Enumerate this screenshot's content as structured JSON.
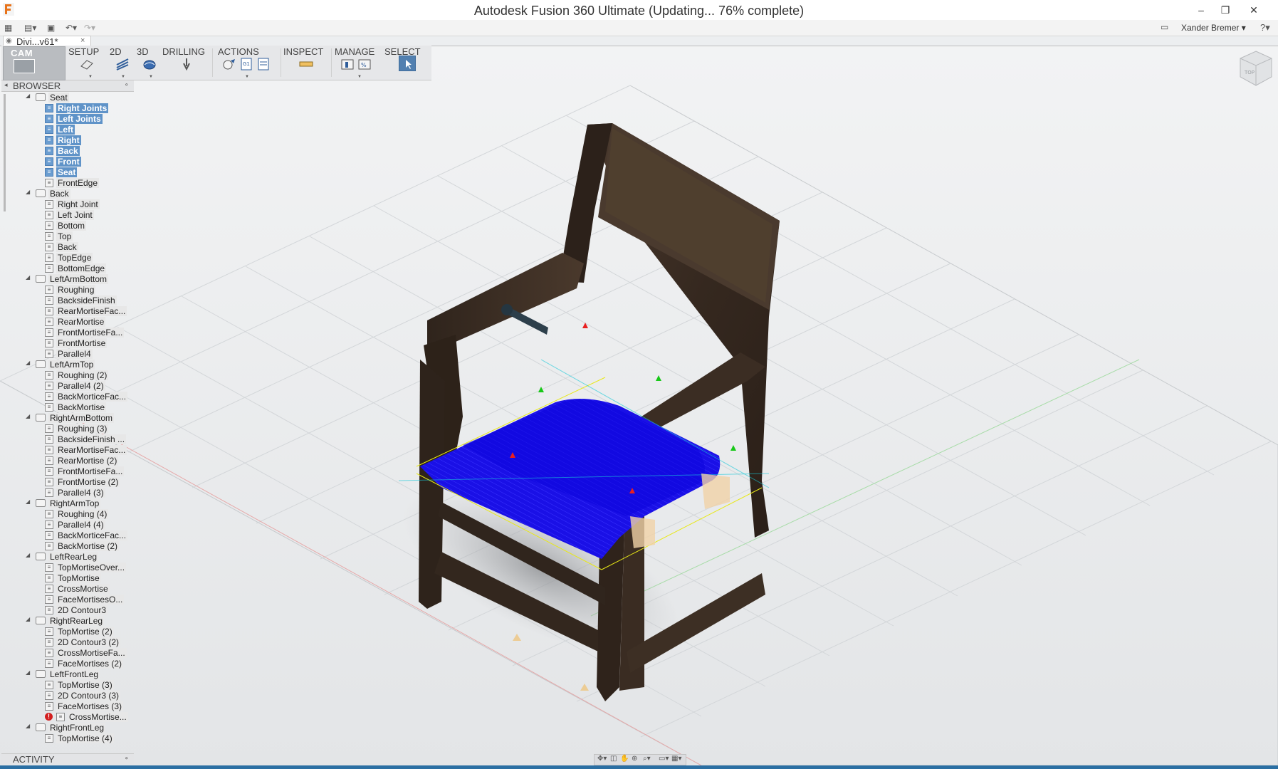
{
  "window": {
    "title": "Autodesk Fusion 360 Ultimate  (Updating... 76% complete)",
    "minimize": "–",
    "maximize": "❐",
    "close": "✕"
  },
  "quickaccess": {
    "user": "Xander Bremer ▾",
    "help": "?▾"
  },
  "document": {
    "tab_label": "Divi...v61*",
    "close": "×"
  },
  "ribbon": {
    "workspace": "CAM",
    "groups": [
      "SETUP",
      "2D",
      "3D",
      "DRILLING",
      "ACTIONS",
      "INSPECT",
      "MANAGE",
      "SELECT"
    ]
  },
  "browser": {
    "title": "BROWSER",
    "rows": [
      {
        "label": "Seat",
        "depth": 0,
        "type": "setup"
      },
      {
        "label": "Right Joints",
        "depth": 1,
        "type": "op",
        "selected": true
      },
      {
        "label": "Left Joints",
        "depth": 1,
        "type": "op",
        "selected": true
      },
      {
        "label": "Left",
        "depth": 1,
        "type": "op",
        "selected": true
      },
      {
        "label": "Right",
        "depth": 1,
        "type": "op",
        "selected": true
      },
      {
        "label": "Back",
        "depth": 1,
        "type": "op",
        "selected": true
      },
      {
        "label": "Front",
        "depth": 1,
        "type": "op",
        "selected": true
      },
      {
        "label": "Seat",
        "depth": 1,
        "type": "op",
        "selected": true
      },
      {
        "label": "FrontEdge",
        "depth": 1,
        "type": "op"
      },
      {
        "label": "Back",
        "depth": 0,
        "type": "setup"
      },
      {
        "label": "Right Joint",
        "depth": 1,
        "type": "op"
      },
      {
        "label": "Left Joint",
        "depth": 1,
        "type": "op"
      },
      {
        "label": "Bottom",
        "depth": 1,
        "type": "op"
      },
      {
        "label": "Top",
        "depth": 1,
        "type": "op"
      },
      {
        "label": "Back",
        "depth": 1,
        "type": "op"
      },
      {
        "label": "TopEdge",
        "depth": 1,
        "type": "op"
      },
      {
        "label": "BottomEdge",
        "depth": 1,
        "type": "op"
      },
      {
        "label": "LeftArmBottom",
        "depth": 0,
        "type": "setup"
      },
      {
        "label": "Roughing",
        "depth": 1,
        "type": "op"
      },
      {
        "label": "BacksideFinish",
        "depth": 1,
        "type": "op"
      },
      {
        "label": "RearMortiseFac...",
        "depth": 1,
        "type": "op"
      },
      {
        "label": "RearMortise",
        "depth": 1,
        "type": "op"
      },
      {
        "label": "FrontMortiseFa...",
        "depth": 1,
        "type": "op"
      },
      {
        "label": "FrontMortise",
        "depth": 1,
        "type": "op"
      },
      {
        "label": "Parallel4",
        "depth": 1,
        "type": "op"
      },
      {
        "label": "LeftArmTop",
        "depth": 0,
        "type": "setup"
      },
      {
        "label": "Roughing (2)",
        "depth": 1,
        "type": "op"
      },
      {
        "label": "Parallel4 (2)",
        "depth": 1,
        "type": "op"
      },
      {
        "label": "BackMorticeFac...",
        "depth": 1,
        "type": "op"
      },
      {
        "label": "BackMortise",
        "depth": 1,
        "type": "op"
      },
      {
        "label": "RightArmBottom",
        "depth": 0,
        "type": "setup"
      },
      {
        "label": "Roughing (3)",
        "depth": 1,
        "type": "op"
      },
      {
        "label": "BacksideFinish ...",
        "depth": 1,
        "type": "op"
      },
      {
        "label": "RearMortiseFac...",
        "depth": 1,
        "type": "op"
      },
      {
        "label": "RearMortise (2)",
        "depth": 1,
        "type": "op"
      },
      {
        "label": "FrontMortiseFa...",
        "depth": 1,
        "type": "op"
      },
      {
        "label": "FrontMortise (2)",
        "depth": 1,
        "type": "op"
      },
      {
        "label": "Parallel4 (3)",
        "depth": 1,
        "type": "op"
      },
      {
        "label": "RightArmTop",
        "depth": 0,
        "type": "setup"
      },
      {
        "label": "Roughing (4)",
        "depth": 1,
        "type": "op"
      },
      {
        "label": "Parallel4 (4)",
        "depth": 1,
        "type": "op"
      },
      {
        "label": "BackMorticeFac...",
        "depth": 1,
        "type": "op"
      },
      {
        "label": "BackMortise (2)",
        "depth": 1,
        "type": "op"
      },
      {
        "label": "LeftRearLeg",
        "depth": 0,
        "type": "setup"
      },
      {
        "label": "TopMortiseOver...",
        "depth": 1,
        "type": "op"
      },
      {
        "label": "TopMortise",
        "depth": 1,
        "type": "op"
      },
      {
        "label": "CrossMortise",
        "depth": 1,
        "type": "op"
      },
      {
        "label": "FaceMortisesO...",
        "depth": 1,
        "type": "op"
      },
      {
        "label": "2D Contour3",
        "depth": 1,
        "type": "op"
      },
      {
        "label": "RightRearLeg",
        "depth": 0,
        "type": "setup"
      },
      {
        "label": "TopMortise (2)",
        "depth": 1,
        "type": "op"
      },
      {
        "label": "2D Contour3 (2)",
        "depth": 1,
        "type": "op"
      },
      {
        "label": "CrossMortiseFa...",
        "depth": 1,
        "type": "op"
      },
      {
        "label": "FaceMortises (2)",
        "depth": 1,
        "type": "op"
      },
      {
        "label": "LeftFrontLeg",
        "depth": 0,
        "type": "setup"
      },
      {
        "label": "TopMortise (3)",
        "depth": 1,
        "type": "op"
      },
      {
        "label": "2D Contour3 (3)",
        "depth": 1,
        "type": "op"
      },
      {
        "label": "FaceMortises (3)",
        "depth": 1,
        "type": "op"
      },
      {
        "label": "CrossMortise...",
        "depth": 1,
        "type": "op",
        "error": true
      },
      {
        "label": "RightFrontLeg",
        "depth": 0,
        "type": "setup"
      },
      {
        "label": "TopMortise (4)",
        "depth": 1,
        "type": "op"
      }
    ]
  },
  "activity": {
    "title": "ACTIVITY"
  },
  "viewcube": {
    "icon": "viewcube-icon"
  },
  "colors": {
    "toolpath": "#1a10e6",
    "wood": "#3a2c22",
    "selection": "#5f93c8",
    "grid_bg": "#eaecee"
  }
}
